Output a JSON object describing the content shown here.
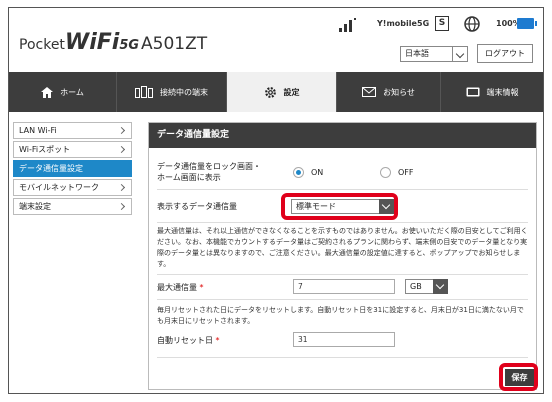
{
  "header": {
    "logo_pocket": "Pocket",
    "logo_wifi": "WiFi",
    "logo_5g": "5G",
    "model": "A501ZT",
    "carrier": "Y!mobile",
    "network": "5G",
    "sim_label": "S",
    "battery": "100%",
    "language": "日本語",
    "logout_label": "ログアウト"
  },
  "nav": {
    "tabs": [
      {
        "label": "ホーム",
        "icon": "home-icon"
      },
      {
        "label": "接続中の端末",
        "icon": "devices-icon"
      },
      {
        "label": "設定",
        "icon": "gear-icon"
      },
      {
        "label": "お知らせ",
        "icon": "mail-icon"
      },
      {
        "label": "端末情報",
        "icon": "device-info-icon"
      }
    ],
    "active": "設定"
  },
  "sidebar": {
    "items": [
      {
        "label": "LAN Wi-Fi"
      },
      {
        "label": "Wi-Fiスポット"
      },
      {
        "label": "データ通信量設定"
      },
      {
        "label": "モバイルネットワーク"
      },
      {
        "label": "端末設定"
      }
    ],
    "active": "データ通信量設定"
  },
  "main": {
    "title": "データ通信量設定",
    "lock_label_1": "データ通信量をロック画面・",
    "lock_label_2": "ホーム画面に表示",
    "lock_on": "ON",
    "lock_off": "OFF",
    "display_label": "表示するデータ通信量",
    "display_value": "標準モード",
    "note1": "最大通信量は、それ以上通信ができなくなることを示すものではありません。お使いいただく際の目安としてご利用ください。なお、本機能でカウントするデータ量はご契約されるプランに関わらず、端末側の目安でのデータ量となり実際のデータ量とは異なりますので、ご注意ください。最大通信量の設定値に達すると、ポップアップでお知らせします。",
    "max_label": "最大通信量",
    "max_value": "7",
    "unit_value": "GB",
    "note2": "毎月リセットされた日にデータをリセットします。自動リセット日を31に設定すると、月末日が31日に満たない月でも月末日にリセットされます。",
    "reset_label": "自動リセット日",
    "reset_value": "31",
    "required_mark": "*",
    "save_label": "保存"
  },
  "colors": {
    "accent": "#1e88c8",
    "nav_bg": "#3d3d3d",
    "highlight": "#e0001b"
  }
}
